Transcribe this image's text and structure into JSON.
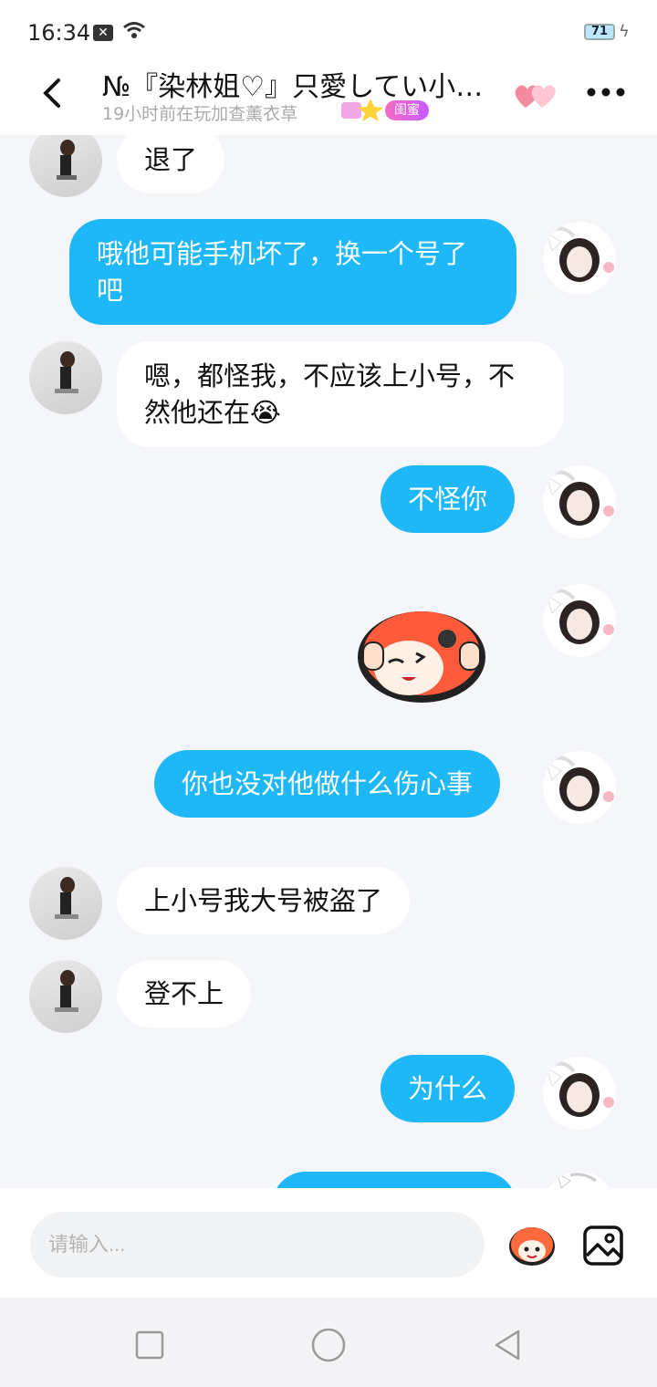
{
  "status_bar": {
    "time": "16:34",
    "battery": "71"
  },
  "header": {
    "title": "№『染林姐♡』只愛してい小…",
    "subtitle": "19小时前在玩加查薰衣草",
    "tag": "闺蜜"
  },
  "messages": [
    {
      "side": "left",
      "text": "退了"
    },
    {
      "side": "right",
      "text": "哦他可能手机坏了，换一个号了吧"
    },
    {
      "side": "left",
      "text": "嗯，都怪我，不应该上小号，不然他还在😭"
    },
    {
      "side": "right",
      "text": "不怪你"
    },
    {
      "side": "right",
      "sticker": "sticker"
    },
    {
      "side": "right",
      "text": "你也没对他做什么伤心事"
    },
    {
      "side": "left",
      "text": "上小号我大号被盗了"
    },
    {
      "side": "left",
      "text": "登不上"
    },
    {
      "side": "right",
      "text": "为什么"
    }
  ],
  "input": {
    "placeholder": "请输入..."
  },
  "icons": {
    "back": "chevron-left-icon",
    "more": "more-dots-icon",
    "emoji": "emoji-sticker-icon",
    "image": "image-icon",
    "nav_recent": "square-icon",
    "nav_home": "circle-icon",
    "nav_back": "triangle-back-icon"
  },
  "colors": {
    "bubble_self": "#1eb7f7",
    "bubble_other": "#ffffff",
    "background": "#f4f6f9"
  }
}
